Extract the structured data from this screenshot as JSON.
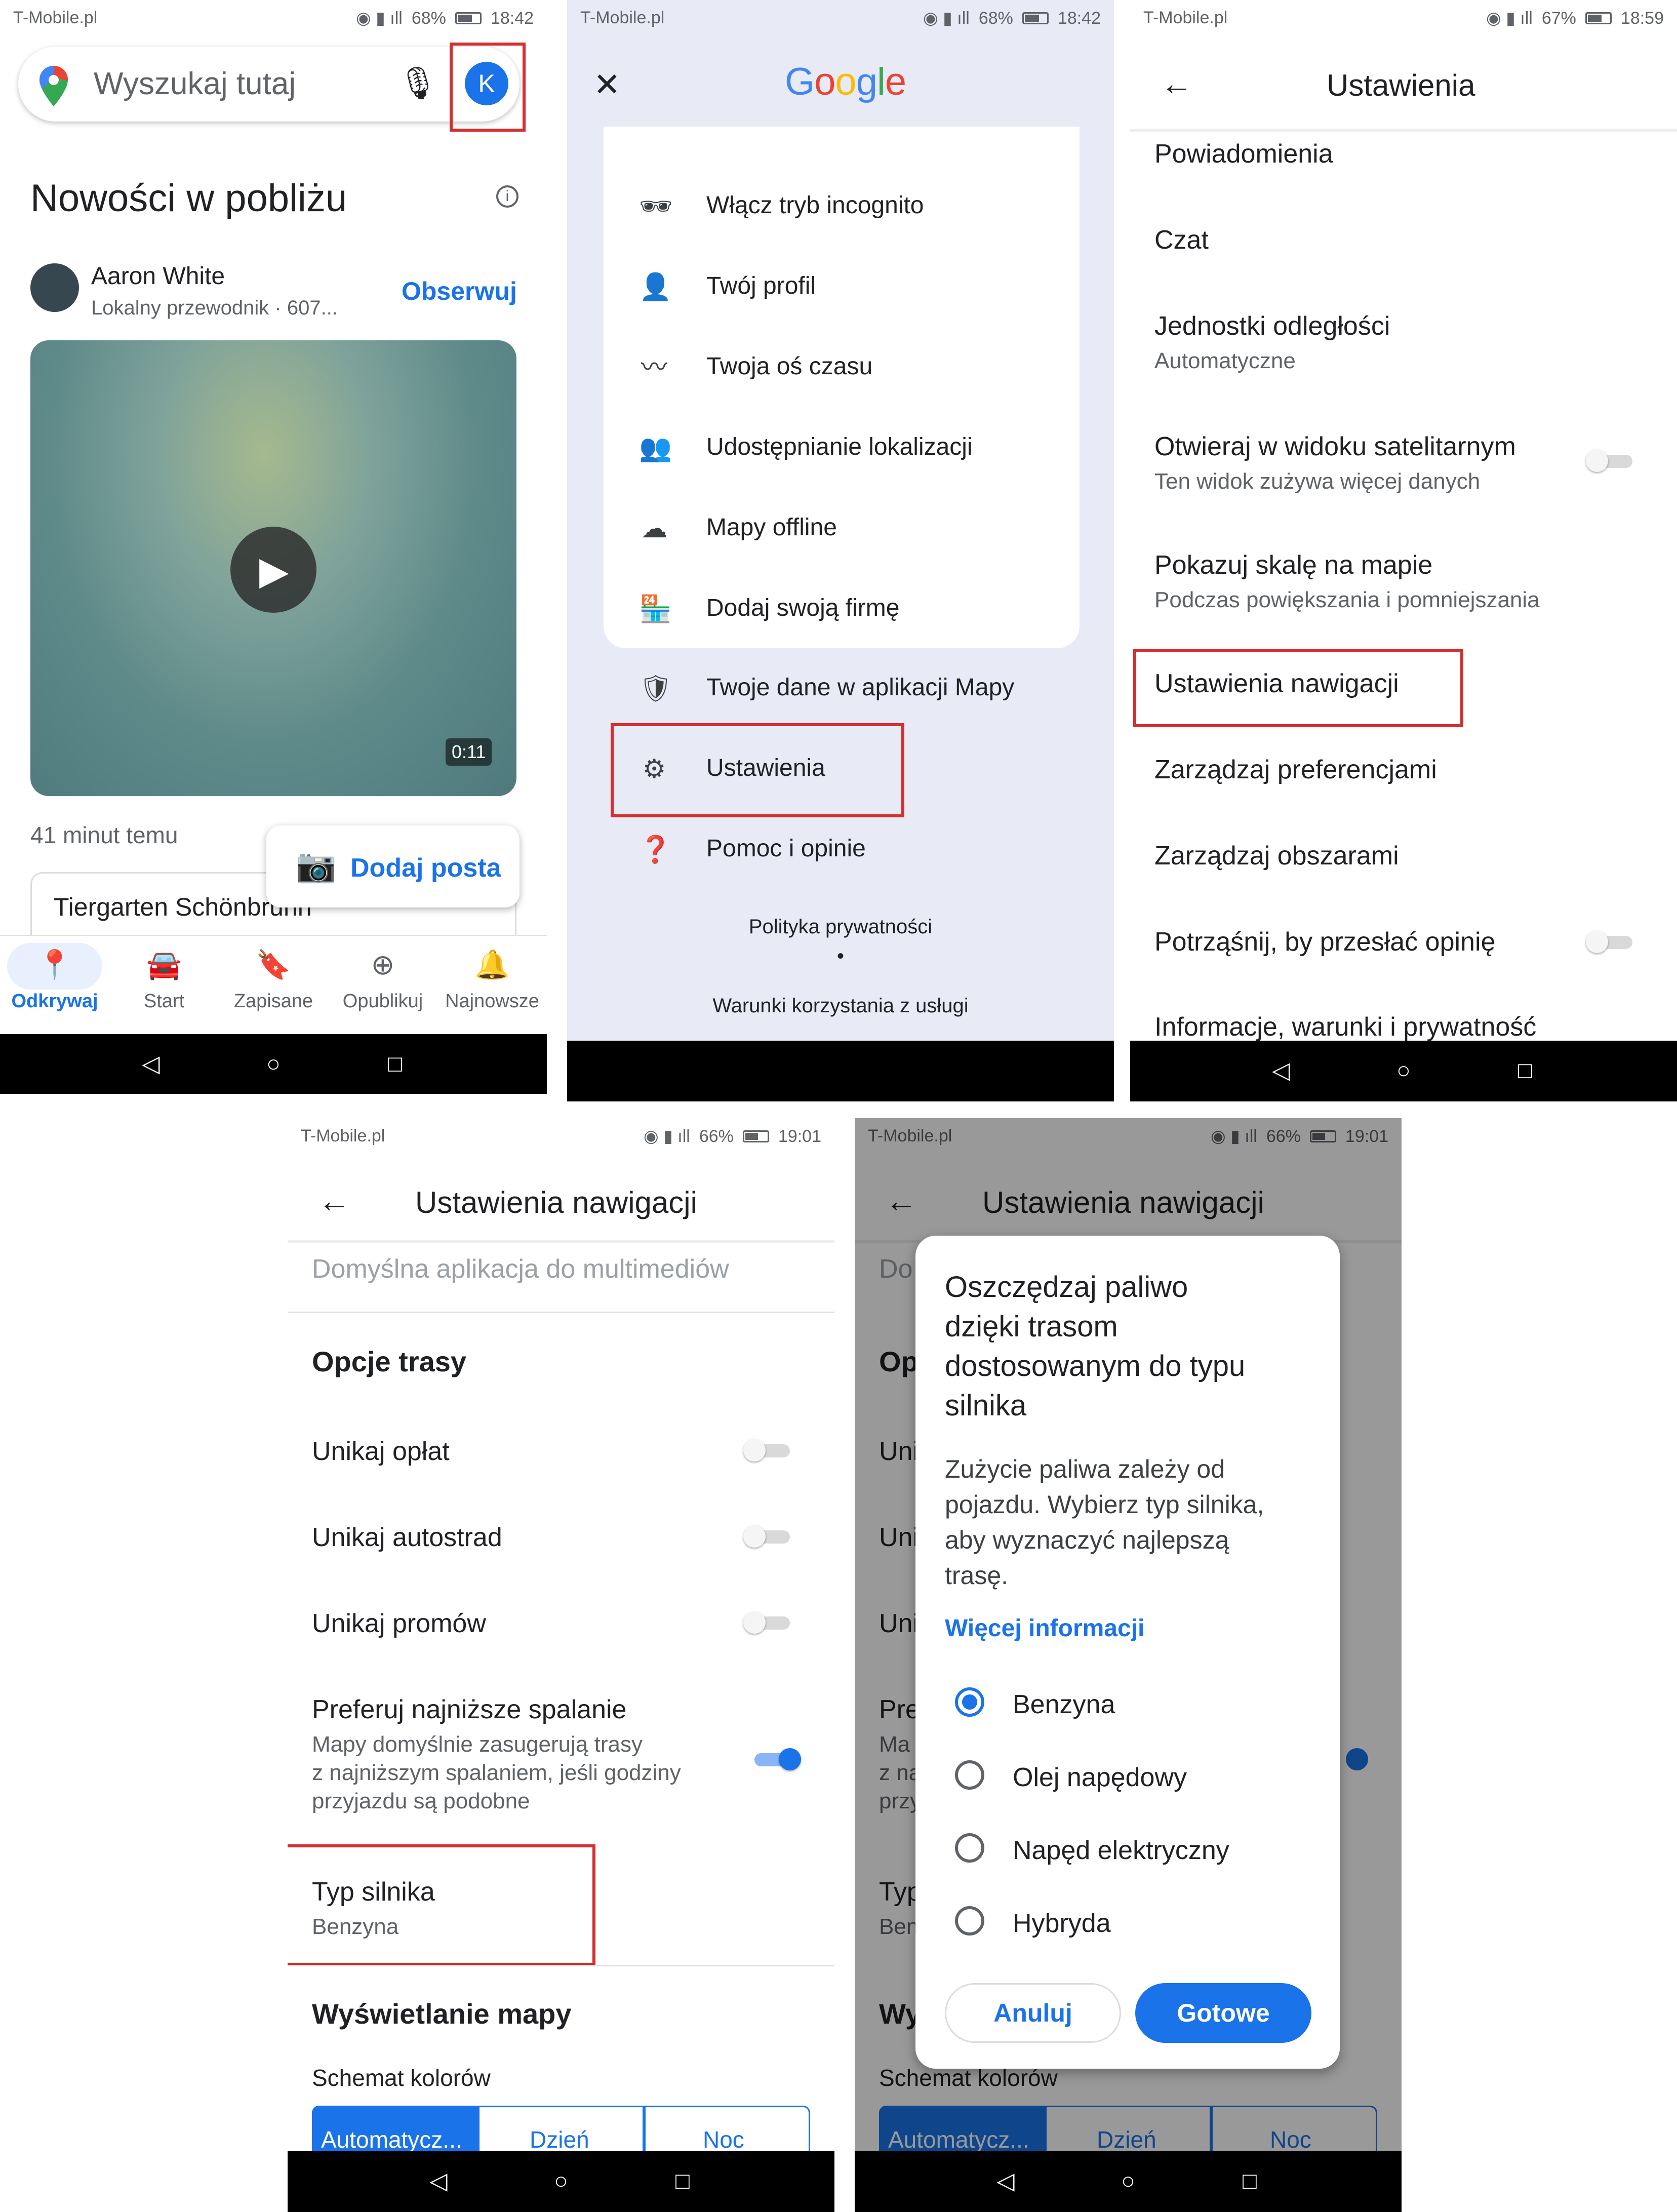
{
  "panel1": {
    "status": {
      "carrier": "T-Mobile.pl",
      "battery": "68%",
      "time": "18:42"
    },
    "search_placeholder": "Wyszukaj tutaj",
    "avatar_letter": "K",
    "section_title": "Nowości w pobliżu",
    "post": {
      "author": "Aaron White",
      "subtitle": "Lokalny przewodnik · 607...",
      "follow_label": "Obserwuj",
      "video_duration": "0:11",
      "time_ago": "41 minut temu"
    },
    "add_post_label": "Dodaj posta",
    "card_title": "Tiergarten Schönbrunn",
    "bottom_nav": [
      {
        "label": "Odkrywaj",
        "icon": "location-pin-icon"
      },
      {
        "label": "Start",
        "icon": "car-icon"
      },
      {
        "label": "Zapisane",
        "icon": "bookmark-icon"
      },
      {
        "label": "Opublikuj",
        "icon": "add-circle-icon"
      },
      {
        "label": "Najnowsze",
        "icon": "bell-icon"
      }
    ]
  },
  "panel2": {
    "status": {
      "carrier": "T-Mobile.pl",
      "battery": "68%",
      "time": "18:42"
    },
    "logo": "Google",
    "menu": [
      {
        "label": "Włącz tryb incognito",
        "icon": "incognito-icon"
      },
      {
        "label": "Twój profil",
        "icon": "person-icon"
      },
      {
        "label": "Twoja oś czasu",
        "icon": "timeline-icon"
      },
      {
        "label": "Udostępnianie lokalizacji",
        "icon": "location-sharing-icon"
      },
      {
        "label": "Mapy offline",
        "icon": "cloud-off-icon"
      },
      {
        "label": "Dodaj swoją firmę",
        "icon": "store-icon"
      }
    ],
    "menu2": [
      {
        "label": "Twoje dane w aplikacji Mapy",
        "icon": "shield-icon"
      },
      {
        "label": "Ustawienia",
        "icon": "gear-icon"
      },
      {
        "label": "Pomoc i opinie",
        "icon": "help-icon"
      }
    ],
    "privacy_label": "Polityka prywatności",
    "dot": "•",
    "terms_label": "Warunki korzystania z usługi"
  },
  "panel3": {
    "status": {
      "carrier": "T-Mobile.pl",
      "battery": "67%",
      "time": "18:59"
    },
    "title": "Ustawienia",
    "items": [
      {
        "title": "Powiadomienia"
      },
      {
        "title": "Czat"
      },
      {
        "title": "Jednostki odległości",
        "subtitle": "Automatyczne"
      },
      {
        "title": "Otwieraj w widoku satelitarnym",
        "subtitle": "Ten widok zużywa więcej danych",
        "toggle": false
      },
      {
        "title": "Pokazuj skalę na mapie",
        "subtitle": "Podczas powiększania i pomniejszania"
      },
      {
        "title": "Ustawienia nawigacji"
      },
      {
        "title": "Zarządzaj preferencjami"
      },
      {
        "title": "Zarządzaj obszarami"
      },
      {
        "title": "Potrząśnij, by przesłać opinię",
        "toggle": false
      },
      {
        "title": "Informacje, warunki i prywatność"
      }
    ]
  },
  "panel4": {
    "status": {
      "carrier": "T-Mobile.pl",
      "battery": "66%",
      "time": "19:01"
    },
    "title": "Ustawienia nawigacji",
    "media_app": "Domyślna aplikacja do multimediów",
    "route_header": "Opcje trasy",
    "avoid_tolls": "Unikaj opłat",
    "avoid_highways": "Unikaj autostrad",
    "avoid_ferries": "Unikaj promów",
    "eco_title": "Preferuj najniższe spalanie",
    "eco_desc_1": "Mapy domyślnie zasugerują trasy",
    "eco_desc_2": "z najniższym spalaniem, jeśli godziny",
    "eco_desc_3": "przyjazdu są podobne",
    "engine_title": "Typ silnika",
    "engine_value": "Benzyna",
    "map_display_header": "Wyświetlanie mapy",
    "color_scheme": "Schemat kolorów",
    "scheme_options": [
      "Automatycz...",
      "Dzień",
      "Noc"
    ]
  },
  "panel5": {
    "status": {
      "carrier": "T-Mobile.pl",
      "battery": "66%",
      "time": "19:01"
    },
    "title": "Ustawienia nawigacji",
    "dialog": {
      "title_lines": [
        "Oszczędzaj paliwo",
        "dzięki trasom",
        "dostosowanym do typu",
        "silnika"
      ],
      "body_lines": [
        "Zużycie paliwa zależy od",
        "pojazdu. Wybierz typ silnika,",
        "aby wyznaczyć najlepszą",
        "trasę."
      ],
      "more_info": "Więcej informacji",
      "options": [
        "Benzyna",
        "Olej napędowy",
        "Napęd elektryczny",
        "Hybryda"
      ],
      "selected_option": "Benzyna",
      "cancel": "Anuluj",
      "done": "Gotowe"
    },
    "bg": {
      "c1": "Do",
      "c2": "Op",
      "c3": "Uni",
      "c4": "Uni",
      "c5": "Uni",
      "c6": "Pre",
      "c7": "Ma",
      "c8": "z na",
      "c9": "przy",
      "c10": "Typ",
      "c11": "Ben",
      "c12": "Wy",
      "c13": "Schemat kolorów"
    }
  },
  "nav_buttons": {
    "back": "◁",
    "home": "○",
    "recent": "□"
  },
  "colors": {
    "accent": "#1a73e8",
    "highlight": "#d32f2f"
  }
}
